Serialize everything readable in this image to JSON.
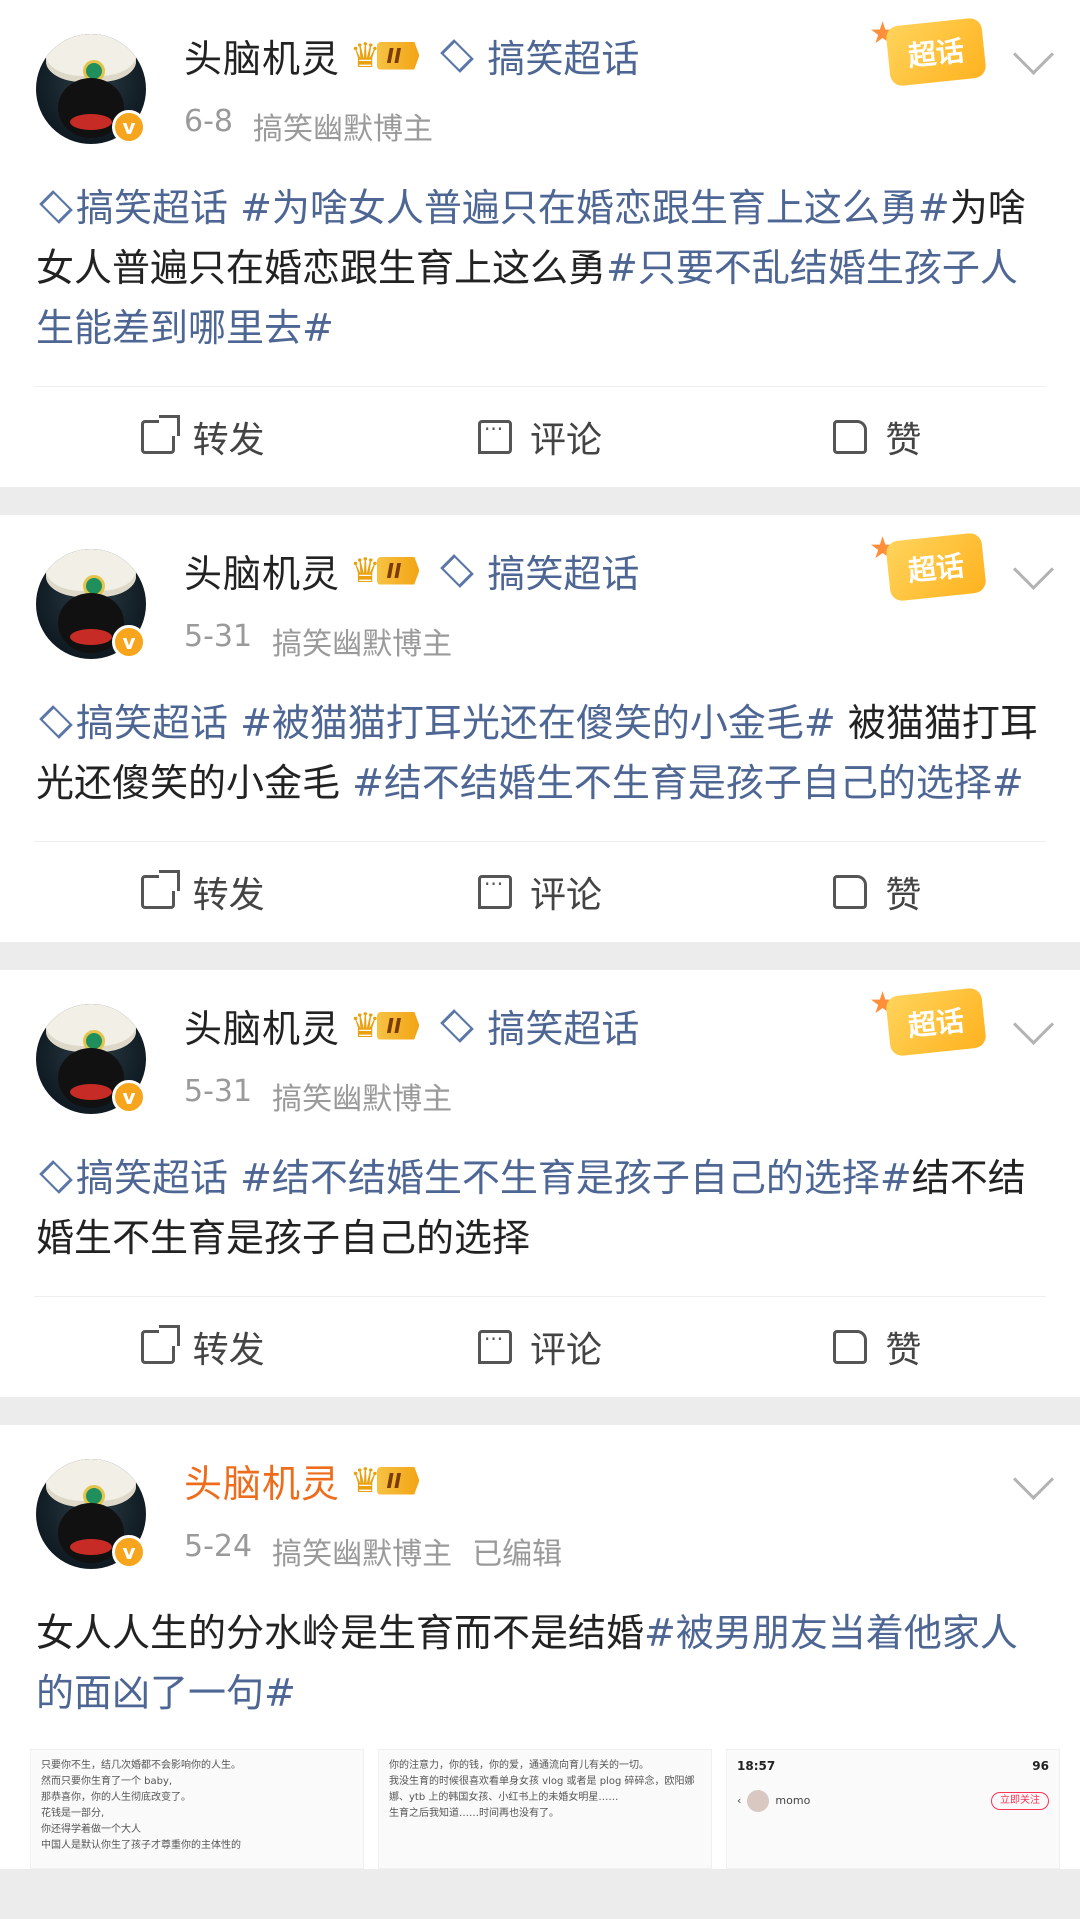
{
  "posts": [
    {
      "username": "头脑机灵",
      "rank_label": "II",
      "topic_link": "搞笑超话",
      "date": "6-8",
      "role": "搞笑幽默博主",
      "edited": "",
      "badge": "超话",
      "segments": [
        {
          "t": "搞笑超话 ",
          "tag": true,
          "icon": true
        },
        {
          "t": "#为啥女人普遍只在婚恋跟生育上这么勇#",
          "tag": true
        },
        {
          "t": "为啥女人普遍只在婚恋跟生育上这么勇",
          "tag": false
        },
        {
          "t": "#只要不乱结婚生孩子人生能差到哪里去#",
          "tag": true
        }
      ]
    },
    {
      "username": "头脑机灵",
      "rank_label": "II",
      "topic_link": "搞笑超话",
      "date": "5-31",
      "role": "搞笑幽默博主",
      "edited": "",
      "badge": "超话",
      "segments": [
        {
          "t": "搞笑超话 ",
          "tag": true,
          "icon": true
        },
        {
          "t": "#被猫猫打耳光还在傻笑的小金毛#",
          "tag": true
        },
        {
          "t": " 被猫猫打耳光还傻笑的小金毛 ",
          "tag": false
        },
        {
          "t": "#结不结婚生不生育是孩子自己的选择#",
          "tag": true
        }
      ]
    },
    {
      "username": "头脑机灵",
      "rank_label": "II",
      "topic_link": "搞笑超话",
      "date": "5-31",
      "role": "搞笑幽默博主",
      "edited": "",
      "badge": "超话",
      "segments": [
        {
          "t": "搞笑超话 ",
          "tag": true,
          "icon": true
        },
        {
          "t": "#结不结婚生不生育是孩子自己的选择#",
          "tag": true
        },
        {
          "t": "结不结婚生不生育是孩子自己的选择",
          "tag": false
        }
      ]
    }
  ],
  "last_post": {
    "username": "头脑机灵",
    "rank_label": "II",
    "date": "5-24",
    "role": "搞笑幽默博主",
    "edited": "已编辑",
    "segments": [
      {
        "t": "女人人生的分水岭是生育而不是结婚",
        "tag": false
      },
      {
        "t": "#被男朋友当着他家人的面凶了一句#",
        "tag": true
      }
    ],
    "thumbs": [
      {
        "lines": [
          "只要你不生，结几次婚都不会影响你的人生。",
          "然而只要你生育了一个 baby,",
          "那恭喜你，你的人生彻底改变了。",
          "花钱是一部分,",
          "你还得学着做一个大人",
          "中国人是默认你生了孩子才尊重你的主体性的"
        ]
      },
      {
        "lines": [
          "你的注意力，你的钱，你的爱，通通流向育儿有关的一切。",
          "我没生育的时候很喜欢看单身女孩 vlog 或者是 plog 碎碎念，欧阳娜娜、ytb 上的韩国女孩、小红书上的未婚女明星……",
          "生育之后我知道……时间再也没有了。"
        ]
      },
      {
        "time": "18:57",
        "status": "96",
        "user": "momo",
        "follow": "立即关注"
      }
    ]
  },
  "actions": {
    "share": "转发",
    "comment": "评论",
    "like": "赞"
  }
}
